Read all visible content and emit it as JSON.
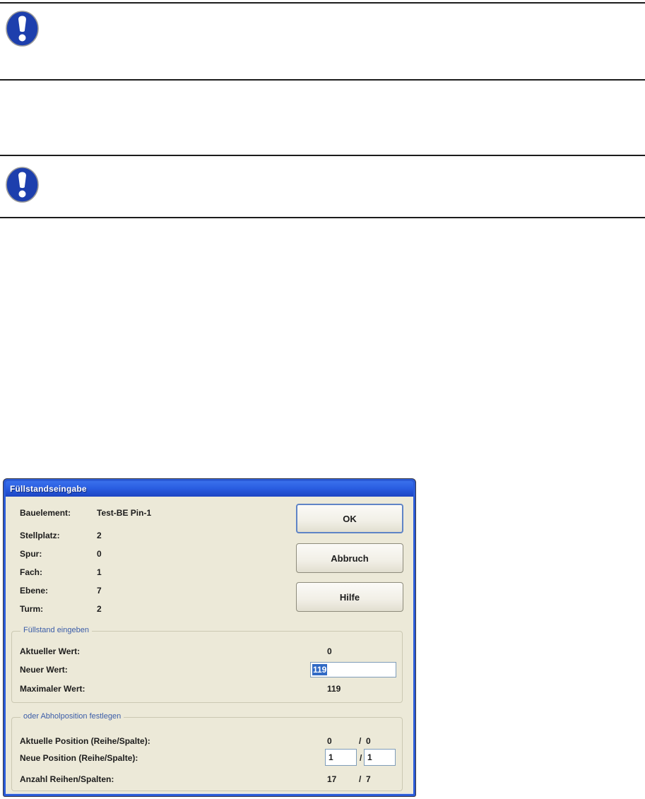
{
  "page": {
    "note_icon": "exclamation-notice"
  },
  "dialog": {
    "title": "Füllstandseingabe",
    "info": {
      "rows": [
        {
          "label": "Bauelement:",
          "value": "Test-BE Pin-1"
        },
        {
          "label": "Stellplatz:",
          "value": "2"
        },
        {
          "label": "Spur:",
          "value": "0"
        },
        {
          "label": "Fach:",
          "value": "1"
        },
        {
          "label": "Ebene:",
          "value": "7"
        },
        {
          "label": "Turm:",
          "value": "2"
        }
      ]
    },
    "buttons": {
      "ok": "OK",
      "cancel": "Abbruch",
      "help": "Hilfe"
    },
    "fill_group": {
      "title": "Füllstand eingeben",
      "current_label": "Aktueller Wert:",
      "current_value": "0",
      "new_label": "Neuer Wert:",
      "new_value": "119",
      "max_label": "Maximaler Wert:",
      "max_value": "119"
    },
    "position_group": {
      "title": "oder Abholposition festlegen",
      "separator": "/",
      "current_label": "Aktuelle Position (Reihe/Spalte):",
      "current_row": "0",
      "current_col": "0",
      "new_label": "Neue Position (Reihe/Spalte):",
      "new_row": "1",
      "new_col": "1",
      "count_label": "Anzahl Reihen/Spalten:",
      "count_rows": "17",
      "count_cols": "7"
    },
    "colors": {
      "titlebar_blue": "#2a5ee2",
      "window_border": "#2b5bd7",
      "dialog_background": "#ece9d8",
      "selection_highlight": "#316ac5",
      "group_label_blue": "#3a5ca8",
      "notice_icon_blue": "#1d3fad"
    }
  }
}
